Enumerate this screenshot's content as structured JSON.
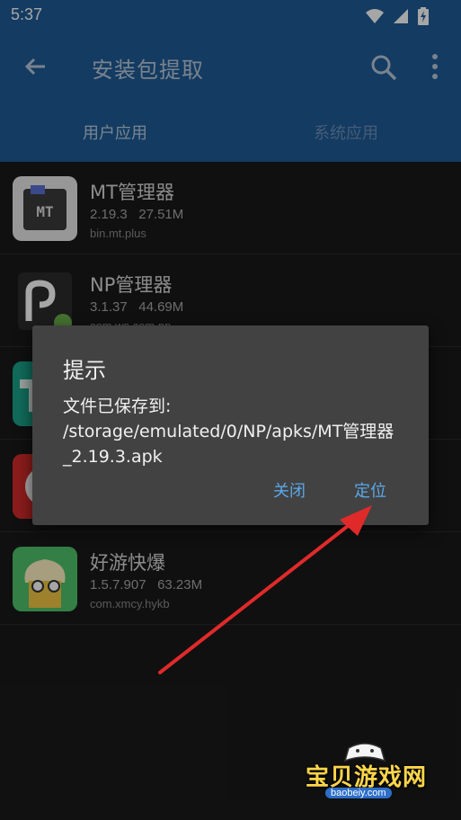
{
  "status_bar": {
    "time": "5:37",
    "icons": [
      "wifi-icon",
      "signal-icon",
      "battery-charging-icon"
    ]
  },
  "app_bar": {
    "title": "安装包提取",
    "icons": [
      "back-arrow-icon",
      "search-icon",
      "more-vert-icon"
    ]
  },
  "tabs": [
    {
      "label": "用户应用",
      "selected": true
    },
    {
      "label": "系统应用",
      "selected": false
    }
  ],
  "apps": [
    {
      "name": "MT管理器",
      "version": "2.19.3",
      "size": "27.51M",
      "package": "bin.mt.plus"
    },
    {
      "name": "NP管理器",
      "version": "3.1.37",
      "size": "44.69M",
      "package": "com.ws.com.np"
    },
    {
      "name": "",
      "version": "",
      "size": "",
      "package": ""
    },
    {
      "name": "",
      "version": "",
      "size": "",
      "package": ""
    },
    {
      "name": "好游快爆",
      "version": "1.5.7.907",
      "size": "63.23M",
      "package": "com.xmcy.hykb"
    }
  ],
  "dialog": {
    "title": "提示",
    "message": "文件已保存到: /storage/emulated/0/NP/apks/MT管理器_2.19.3.apk",
    "buttons": {
      "close": "关闭",
      "locate": "定位"
    }
  },
  "colors": {
    "app_bar": "#205b95",
    "dialog_bg": "#424242",
    "dialog_button": "#5aa8ea",
    "annotation_arrow": "#e02a2a"
  },
  "watermark": {
    "brand": "宝贝游戏网",
    "url": "baobeiy.com"
  }
}
